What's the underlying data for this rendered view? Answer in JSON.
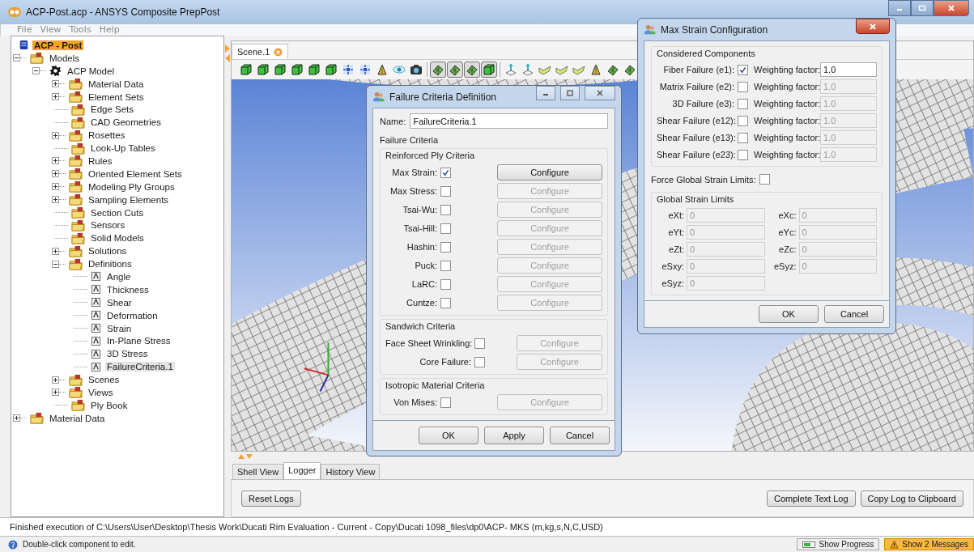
{
  "window": {
    "title": "ACP-Post.acp - ANSYS Composite PrepPost"
  },
  "menu": [
    "File",
    "View",
    "Tools",
    "Help"
  ],
  "tree": [
    {
      "label": "ACP - Post",
      "kind": "root",
      "children": [
        {
          "label": "Models",
          "kind": "folder",
          "expanded": true,
          "children": [
            {
              "label": "ACP Model",
              "kind": "model",
              "expanded": true,
              "children": [
                {
                  "label": "Material Data",
                  "kind": "folder",
                  "expanded": false
                },
                {
                  "label": "Element Sets",
                  "kind": "folder",
                  "expanded": false
                },
                {
                  "label": "Edge Sets",
                  "kind": "leaf"
                },
                {
                  "label": "CAD Geometries",
                  "kind": "leaf"
                },
                {
                  "label": "Rosettes",
                  "kind": "folder",
                  "expanded": false
                },
                {
                  "label": "Look-Up Tables",
                  "kind": "leaf"
                },
                {
                  "label": "Rules",
                  "kind": "folder",
                  "expanded": false
                },
                {
                  "label": "Oriented Element Sets",
                  "kind": "folder",
                  "expanded": false
                },
                {
                  "label": "Modeling Ply Groups",
                  "kind": "folder",
                  "expanded": false
                },
                {
                  "label": "Sampling Elements",
                  "kind": "folder",
                  "expanded": false
                },
                {
                  "label": "Section Cuts",
                  "kind": "leaf"
                },
                {
                  "label": "Sensors",
                  "kind": "leaf"
                },
                {
                  "label": "Solid Models",
                  "kind": "leaf"
                },
                {
                  "label": "Solutions",
                  "kind": "folder",
                  "expanded": false
                },
                {
                  "label": "Definitions",
                  "kind": "folder",
                  "expanded": true,
                  "children": [
                    {
                      "label": "Angle",
                      "kind": "definition",
                      "selected": false
                    },
                    {
                      "label": "Thickness",
                      "kind": "definition",
                      "selected": false
                    },
                    {
                      "label": "Shear",
                      "kind": "definition",
                      "selected": false
                    },
                    {
                      "label": "Deformation",
                      "kind": "definition",
                      "selected": false
                    },
                    {
                      "label": "Strain",
                      "kind": "definition",
                      "selected": false
                    },
                    {
                      "label": "In-Plane Stress",
                      "kind": "definition",
                      "selected": false
                    },
                    {
                      "label": "3D Stress",
                      "kind": "definition",
                      "selected": false
                    },
                    {
                      "label": "FailureCriteria.1",
                      "kind": "definition",
                      "selected": true
                    }
                  ]
                },
                {
                  "label": "Scenes",
                  "kind": "folder",
                  "expanded": false
                },
                {
                  "label": "Views",
                  "kind": "folder",
                  "expanded": false
                },
                {
                  "label": "Ply Book",
                  "kind": "leaf"
                }
              ]
            }
          ]
        },
        {
          "label": "Material Data",
          "kind": "folder",
          "expanded": false
        }
      ]
    }
  ],
  "scene_tab": {
    "label": "Scene.1"
  },
  "toolbar": [
    {
      "kind": "cube",
      "pressed": false
    },
    {
      "kind": "cube",
      "pressed": false
    },
    {
      "kind": "cube",
      "pressed": false
    },
    {
      "kind": "cube",
      "pressed": false
    },
    {
      "kind": "cube",
      "pressed": false
    },
    {
      "kind": "cube",
      "pressed": false
    },
    {
      "kind": "fit",
      "pressed": false
    },
    {
      "kind": "fit",
      "pressed": false
    },
    {
      "kind": "shape",
      "pressed": false
    },
    {
      "kind": "eye",
      "pressed": false
    },
    {
      "kind": "camera",
      "pressed": false
    },
    {
      "kind": "separator"
    },
    {
      "kind": "mesh",
      "pressed": true
    },
    {
      "kind": "mesh",
      "pressed": true
    },
    {
      "kind": "mesh",
      "pressed": true
    },
    {
      "kind": "cube",
      "pressed": true
    },
    {
      "kind": "separator"
    },
    {
      "kind": "pin",
      "pressed": false
    },
    {
      "kind": "pin",
      "pressed": false
    },
    {
      "kind": "ribbon",
      "pressed": false
    },
    {
      "kind": "ribbon",
      "pressed": false
    },
    {
      "kind": "ribbon",
      "pressed": false
    },
    {
      "kind": "shape",
      "pressed": false
    },
    {
      "kind": "mesh",
      "pressed": false
    },
    {
      "kind": "mesh",
      "pressed": false
    }
  ],
  "bottom_tabs": [
    {
      "label": "Shell View",
      "selected": false
    },
    {
      "label": "Logger",
      "selected": true
    },
    {
      "label": "History View",
      "selected": false
    }
  ],
  "logger_buttons": {
    "left": [
      "Reset Logs"
    ],
    "right": [
      "Complete Text Log",
      "Copy Log to Clipboard"
    ]
  },
  "log_message": "Finished execution of C:\\Users\\User\\Desktop\\Thesis Work\\Ducati Rim Evaluation - Current - Copy\\Ducati 1098_files\\dp0\\ACP- MKS (m,kg,s,N,C,USD)",
  "status_bar": {
    "hint": "Double-click component to edit.",
    "buttons": [
      {
        "label": "Show Progress",
        "highlighted": false
      },
      {
        "label": "Show 2 Messages",
        "highlighted": true
      }
    ]
  },
  "failure_dialog": {
    "title": "Failure Criteria Definition",
    "name_label": "Name:",
    "name_value": "FailureCriteria.1",
    "section": "Failure Criteria",
    "groups": [
      {
        "title": "Reinforced Ply Criteria",
        "rows": [
          {
            "label": "Max Strain:",
            "checked": true,
            "button": "Configure",
            "disabled": false
          },
          {
            "label": "Max Stress:",
            "checked": false,
            "button": "Configure",
            "disabled": true
          },
          {
            "label": "Tsai-Wu:",
            "checked": false,
            "button": "Configure",
            "disabled": true
          },
          {
            "label": "Tsai-Hill:",
            "checked": false,
            "button": "Configure",
            "disabled": true
          },
          {
            "label": "Hashin:",
            "checked": false,
            "button": "Configure",
            "disabled": true
          },
          {
            "label": "Puck:",
            "checked": false,
            "button": "Configure",
            "disabled": true
          },
          {
            "label": "LaRC:",
            "checked": false,
            "button": "Configure",
            "disabled": true
          },
          {
            "label": "Cuntze:",
            "checked": false,
            "button": "Configure",
            "disabled": true
          }
        ]
      },
      {
        "title": "Sandwich Criteria",
        "rows": [
          {
            "label": "Face Sheet Wrinkling:",
            "checked": false,
            "button": "Configure",
            "disabled": true
          },
          {
            "label": "Core Failure:",
            "checked": false,
            "button": "Configure",
            "disabled": true
          }
        ]
      },
      {
        "title": "Isotropic Material Criteria",
        "rows": [
          {
            "label": "Von Mises:",
            "checked": false,
            "button": "Configure",
            "disabled": true
          }
        ]
      }
    ],
    "buttons": [
      "OK",
      "Apply",
      "Cancel"
    ]
  },
  "strain_dialog": {
    "title": "Max Strain Configuration",
    "components_title": "Considered Components",
    "components": [
      {
        "label": "Fiber Failure (e1):",
        "checked": true,
        "factor_label": "Weighting factor:",
        "factor": "1.0",
        "disabled": false
      },
      {
        "label": "Matrix Failure (e2):",
        "checked": false,
        "factor_label": "Weighting factor:",
        "factor": "1.0",
        "disabled": true
      },
      {
        "label": "3D Failure (e3):",
        "checked": false,
        "factor_label": "Weighting factor:",
        "factor": "1.0",
        "disabled": true
      },
      {
        "label": "Shear Failure (e12):",
        "checked": false,
        "factor_label": "Weighting factor:",
        "factor": "1.0",
        "disabled": true
      },
      {
        "label": "Shear Failure (e13):",
        "checked": false,
        "factor_label": "Weighting factor:",
        "factor": "1.0",
        "disabled": true
      },
      {
        "label": "Shear Failure (e23):",
        "checked": false,
        "factor_label": "Weighting factor:",
        "factor": "1.0",
        "disabled": true
      }
    ],
    "force_label": "Force Global Strain Limits:",
    "force_checked": false,
    "limits_title": "Global Strain Limits",
    "limits": [
      {
        "label": "eXt:",
        "value": "0",
        "disabled": true
      },
      {
        "label": "eXc:",
        "value": "0",
        "disabled": true
      },
      {
        "label": "eYt:",
        "value": "0",
        "disabled": true
      },
      {
        "label": "eYc:",
        "value": "0",
        "disabled": true
      },
      {
        "label": "eZt:",
        "value": "0",
        "disabled": true
      },
      {
        "label": "eZc:",
        "value": "0",
        "disabled": true
      },
      {
        "label": "eSxy:",
        "value": "0",
        "disabled": true
      },
      {
        "label": "eSyz:",
        "value": "0",
        "disabled": true
      },
      {
        "label": "eSyz:",
        "value": "0",
        "disabled": true
      }
    ],
    "buttons": [
      "OK",
      "Cancel"
    ]
  }
}
